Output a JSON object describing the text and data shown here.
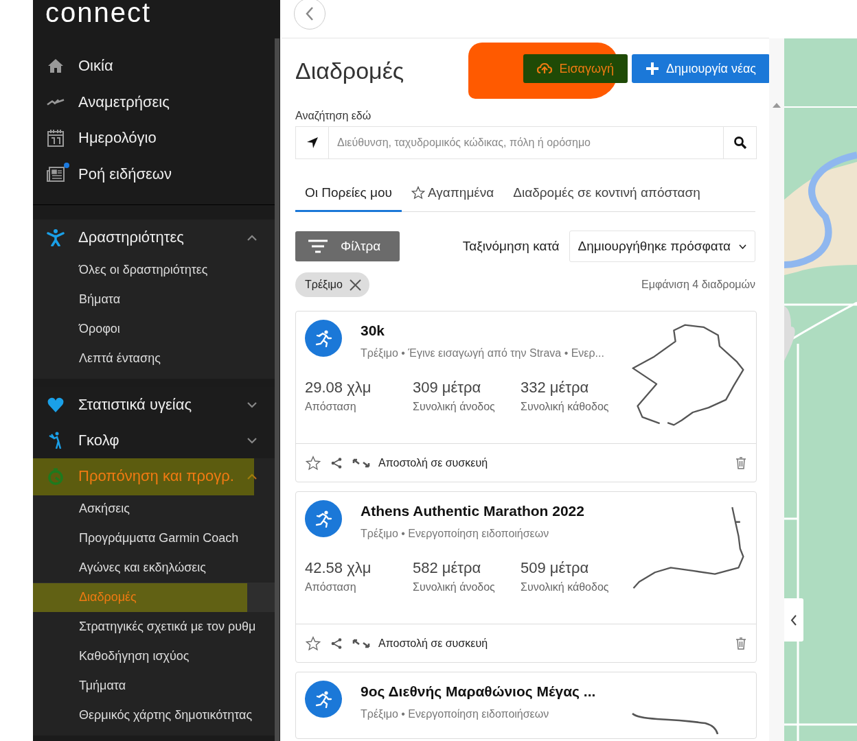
{
  "sidebar": {
    "logo": "connect",
    "nav": [
      {
        "label": "Οικία",
        "badge": false
      },
      {
        "label": "Αναμετρήσεις",
        "badge": false
      },
      {
        "label": "Ημερολόγιο",
        "badge": false
      },
      {
        "label": "Ροή ειδήσεων",
        "badge": true
      }
    ],
    "groups": [
      {
        "label": "Δραστηριότητες",
        "expanded": true,
        "active": false,
        "highlighted": false,
        "items": [
          {
            "label": "Όλες οι δραστηριότητες",
            "selected": false,
            "highlighted": false
          },
          {
            "label": "Βήματα",
            "selected": false,
            "highlighted": false
          },
          {
            "label": "Όροφοι",
            "selected": false,
            "highlighted": false
          },
          {
            "label": "Λεπτά έντασης",
            "selected": false,
            "highlighted": false
          }
        ]
      },
      {
        "label": "Στατιστικά υγείας",
        "expanded": false,
        "active": false,
        "highlighted": false
      },
      {
        "label": "Γκολφ",
        "expanded": false,
        "active": false,
        "highlighted": false
      },
      {
        "label": "Προπόνηση και προγρ.",
        "expanded": true,
        "active": true,
        "highlighted": true,
        "items": [
          {
            "label": "Ασκήσεις",
            "selected": false,
            "highlighted": false
          },
          {
            "label": "Προγράμματα Garmin Coach",
            "selected": false,
            "highlighted": false
          },
          {
            "label": "Αγώνες και εκδηλώσεις",
            "selected": false,
            "highlighted": false
          },
          {
            "label": "Διαδρομές",
            "selected": true,
            "highlighted": true
          },
          {
            "label": "Στρατηγικές σχετικά με τον ρυθμ",
            "selected": false,
            "highlighted": false
          },
          {
            "label": "Καθοδήγηση ισχύος",
            "selected": false,
            "highlighted": false
          },
          {
            "label": "Τμήματα",
            "selected": false,
            "highlighted": false
          },
          {
            "label": "Θερμικός χάρτης δημοτικότητας",
            "selected": false,
            "highlighted": false
          }
        ]
      }
    ]
  },
  "page": {
    "title": "Διαδρομές",
    "buttons": [
      {
        "kind": "import",
        "label": "Εισαγωγή",
        "highlighted": true
      },
      {
        "kind": "create",
        "label": "Δημιουργία νέας",
        "highlighted": false
      }
    ],
    "search": {
      "label": "Αναζήτηση εδώ",
      "placeholder": "Διεύθυνση, ταχυδρομικός κώδικας, πόλη ή ορόσημο"
    },
    "tabs": [
      {
        "label": "Οι Πορείες μου",
        "selected": true
      },
      {
        "label": "Αγαπημένα",
        "selected": false
      },
      {
        "label": "Διαδρομές σε κοντινή απόσταση",
        "selected": false
      }
    ],
    "filters_button": "Φίλτρα",
    "sort": {
      "label": "Ταξινόμηση κατά",
      "value": "Δημιουργήθηκε πρόσφατα"
    },
    "chips": [
      {
        "label": "Τρέξιμο"
      }
    ],
    "count": "Εμφάνιση 4 διαδρομών",
    "routes": [
      {
        "title": "30k",
        "subtitle": "Τρέξιμο • Έγινε εισαγωγή από την Strava • Ενερ...",
        "favorite": false,
        "action": "Αποστολή σε συσκευή",
        "stats": [
          {
            "value": "29.08 χλμ",
            "label": "Απόσταση"
          },
          {
            "value": "309 μέτρα",
            "label": "Συνολική άνοδος"
          },
          {
            "value": "332 μέτρα",
            "label": "Συνολική κάθοδος"
          }
        ]
      },
      {
        "title": "Athens Authentic Marathon 2022",
        "subtitle": "Τρέξιμο • Ενεργοποίηση ειδοποιήσεων",
        "favorite": false,
        "action": "Αποστολή σε συσκευή",
        "stats": [
          {
            "value": "42.58 χλμ",
            "label": "Απόσταση"
          },
          {
            "value": "582 μέτρα",
            "label": "Συνολική άνοδος"
          },
          {
            "value": "509 μέτρα",
            "label": "Συνολική κάθοδος"
          }
        ]
      },
      {
        "title": "9ος Διεθνής Μαραθώνιος Μέγας ...",
        "subtitle": "Τρέξιμο • Ενεργοποίηση ειδοποιήσεων"
      }
    ]
  }
}
